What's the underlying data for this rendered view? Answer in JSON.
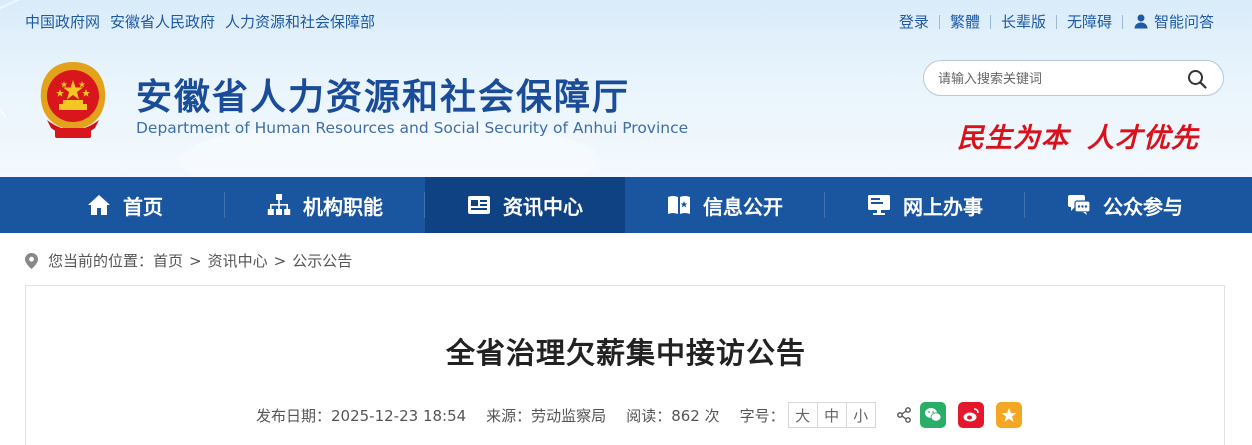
{
  "top_links": [
    "中国政府网",
    "安徽省人民政府",
    "人力资源和社会保障部"
  ],
  "top_right": {
    "login": "登录",
    "traditional": "繁體",
    "elder": "长辈版",
    "accessible": "无障碍",
    "qa": "智能问答"
  },
  "site": {
    "title": "安徽省人力资源和社会保障厅",
    "subtitle": "Department of Human Resources and Social Security of Anhui Province",
    "slogan_1": "民生为本",
    "slogan_2": "人才优先"
  },
  "search": {
    "placeholder": "请输入搜索关键词"
  },
  "nav": [
    {
      "label": "首页",
      "icon": "home-icon"
    },
    {
      "label": "机构职能",
      "icon": "org-chart-icon"
    },
    {
      "label": "资讯中心",
      "icon": "news-icon",
      "active": true
    },
    {
      "label": "信息公开",
      "icon": "open-book-icon"
    },
    {
      "label": "网上办事",
      "icon": "monitor-icon"
    },
    {
      "label": "公众参与",
      "icon": "chat-icon"
    }
  ],
  "breadcrumb": {
    "prefix": "您当前的位置：",
    "items": [
      "首页",
      "资讯中心",
      "公示公告"
    ],
    "separator": ">"
  },
  "article": {
    "title": "全省治理欠薪集中接访公告",
    "publish": "发布日期：2025-12-23 18:54",
    "source": "来源：劳动监察局",
    "reads": "阅读：862 次",
    "font_size_label": "字号：",
    "font_sizes": [
      "大",
      "中",
      "小"
    ]
  },
  "share_icons": [
    "share-icon",
    "wechat-icon",
    "weibo-icon",
    "favorite-icon"
  ],
  "colors": {
    "nav_bg": "#1a56a0",
    "nav_active": "#0f4283",
    "title_blue": "#1a4c97",
    "slogan_red": "#d8111b",
    "wechat_green": "#2aae67",
    "weibo_red": "#e6162d",
    "favorite_orange": "#f5a623"
  }
}
